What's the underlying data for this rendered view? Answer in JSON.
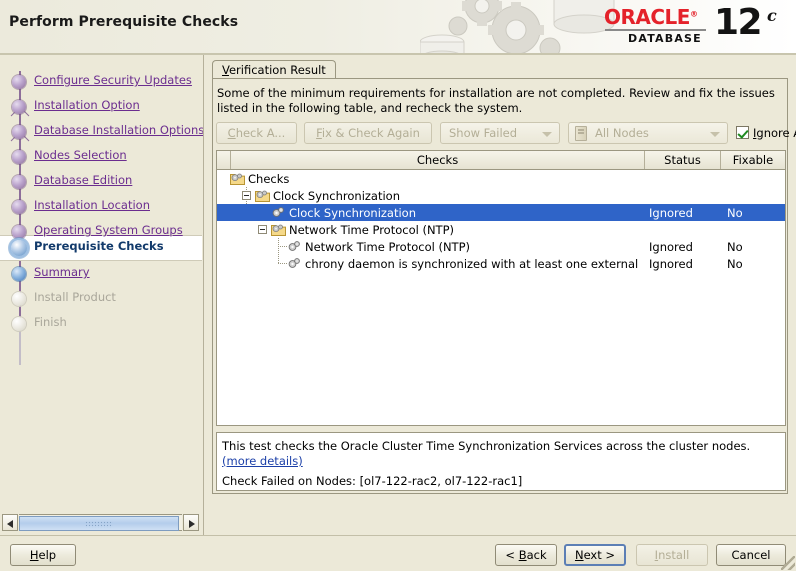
{
  "header": {
    "title": "Perform Prerequisite Checks",
    "brand": "ORACLE",
    "brand_reg": "®",
    "brand_sub": "DATABASE",
    "version_number": "12",
    "version_suffix": "c",
    "accent_color": "#e4222a"
  },
  "sidebar": {
    "items": [
      {
        "label": "Configure Security Updates",
        "state": "link"
      },
      {
        "label": "Installation Option",
        "state": "link"
      },
      {
        "label": "Database Installation Options",
        "state": "link"
      },
      {
        "label": "Nodes Selection",
        "state": "link"
      },
      {
        "label": "Database Edition",
        "state": "link"
      },
      {
        "label": "Installation Location",
        "state": "link"
      },
      {
        "label": "Operating System Groups",
        "state": "link"
      },
      {
        "label": "Prerequisite Checks",
        "state": "current"
      },
      {
        "label": "Summary",
        "state": "link-blue"
      },
      {
        "label": "Install Product",
        "state": "disabled"
      },
      {
        "label": "Finish",
        "state": "disabled"
      }
    ],
    "link_color": "#6b2d8f",
    "current_color": "#123a6b"
  },
  "main": {
    "tab_label_mnemonic": "V",
    "tab_label_rest": "erification Result",
    "intro": "Some of the minimum requirements for installation are not completed. Review and fix the issues listed in the following table, and recheck the system.",
    "toolbar": {
      "check_again_mnemonic": "C",
      "check_again_rest": "heck A...",
      "fix_check_mnemonic": "F",
      "fix_check_rest": "ix & Check Again",
      "filter_value": "Show Failed",
      "nodes_value": "All Nodes",
      "ignore_mnemonic": "I",
      "ignore_rest": "gnore A",
      "ignore_checked": true
    },
    "table": {
      "columns": [
        "Checks",
        "Status",
        "Fixable"
      ],
      "rows": [
        {
          "label": "Checks",
          "status": "",
          "fixable": "",
          "depth": 0,
          "icon": "folder-gear-icon",
          "toggle": "none",
          "selected": false
        },
        {
          "label": "Clock Synchronization",
          "status": "",
          "fixable": "",
          "depth": 1,
          "icon": "folder-gear-icon",
          "toggle": "expanded",
          "selected": false
        },
        {
          "label": "Clock Synchronization",
          "status": "Ignored",
          "fixable": "No",
          "depth": 2,
          "icon": "gear-icon",
          "toggle": "none",
          "selected": true
        },
        {
          "label": "Network Time Protocol (NTP)",
          "status": "",
          "fixable": "",
          "depth": 1,
          "icon": "folder-gear-icon",
          "toggle": "expanded",
          "selected": false
        },
        {
          "label": "Network Time Protocol (NTP)",
          "status": "Ignored",
          "fixable": "No",
          "depth": 2,
          "icon": "gear-icon",
          "toggle": "none",
          "selected": false
        },
        {
          "label": "chrony daemon is synchronized with at least one external",
          "status": "Ignored",
          "fixable": "No",
          "depth": 2,
          "icon": "gear-icon",
          "toggle": "none",
          "selected": false
        }
      ],
      "selection_color": "#2f64c8"
    },
    "details": {
      "text_before_link": "This test checks the Oracle Cluster Time Synchronization Services across the cluster nodes. ",
      "link_label": "(more details)",
      "failed_nodes": "Check Failed on Nodes: [ol7-122-rac2, ol7-122-rac1]",
      "link_color": "#1b3fa8"
    }
  },
  "footer": {
    "help_mnemonic": "H",
    "help_rest": "elp",
    "back_prefix": "< ",
    "back_mnemonic": "B",
    "back_rest": "ack",
    "next_mnemonic": "N",
    "next_rest": "ext >",
    "install_mnemonic": "I",
    "install_rest": "nstall",
    "cancel_label": "Cancel"
  }
}
